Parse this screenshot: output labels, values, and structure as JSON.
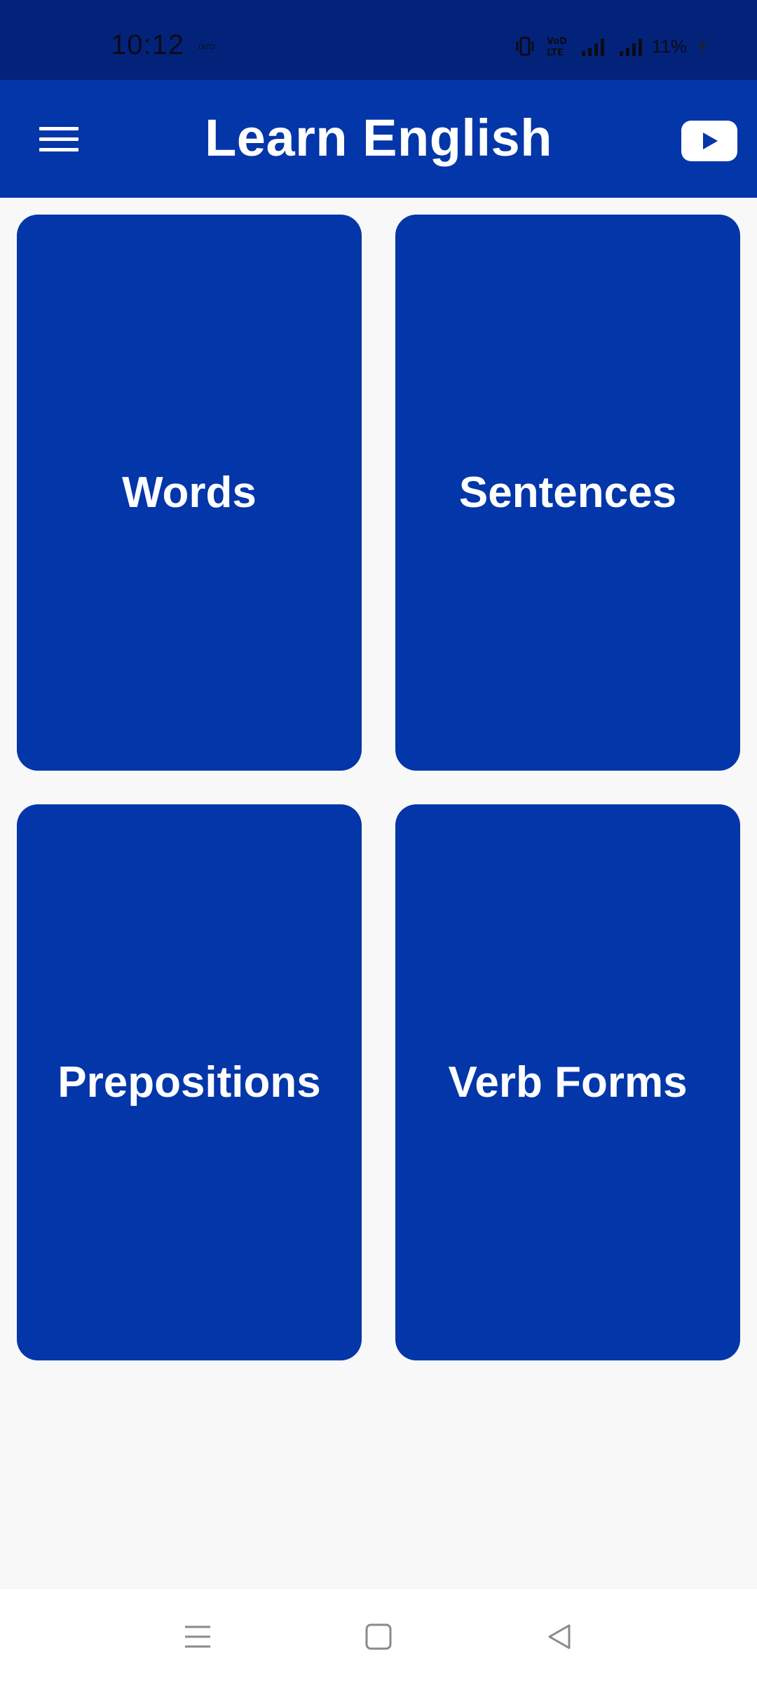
{
  "status_bar": {
    "time": "10:12",
    "carrier_tag": "DIZO",
    "volte_label": "VoLTE",
    "battery_text": "11%"
  },
  "app_bar": {
    "title": "Learn English",
    "menu_icon": "hamburger-menu-icon",
    "youtube_icon": "youtube-icon"
  },
  "cards": [
    {
      "label": "Words"
    },
    {
      "label": "Sentences"
    },
    {
      "label": "Prepositions"
    },
    {
      "label": "Verb Forms"
    }
  ],
  "nav_bar": {
    "recents_icon": "recents-icon",
    "home_icon": "home-icon",
    "back_icon": "back-icon"
  },
  "colors": {
    "status_bar": "#03237a",
    "primary": "#0336a8",
    "background": "#f8f8f8"
  }
}
